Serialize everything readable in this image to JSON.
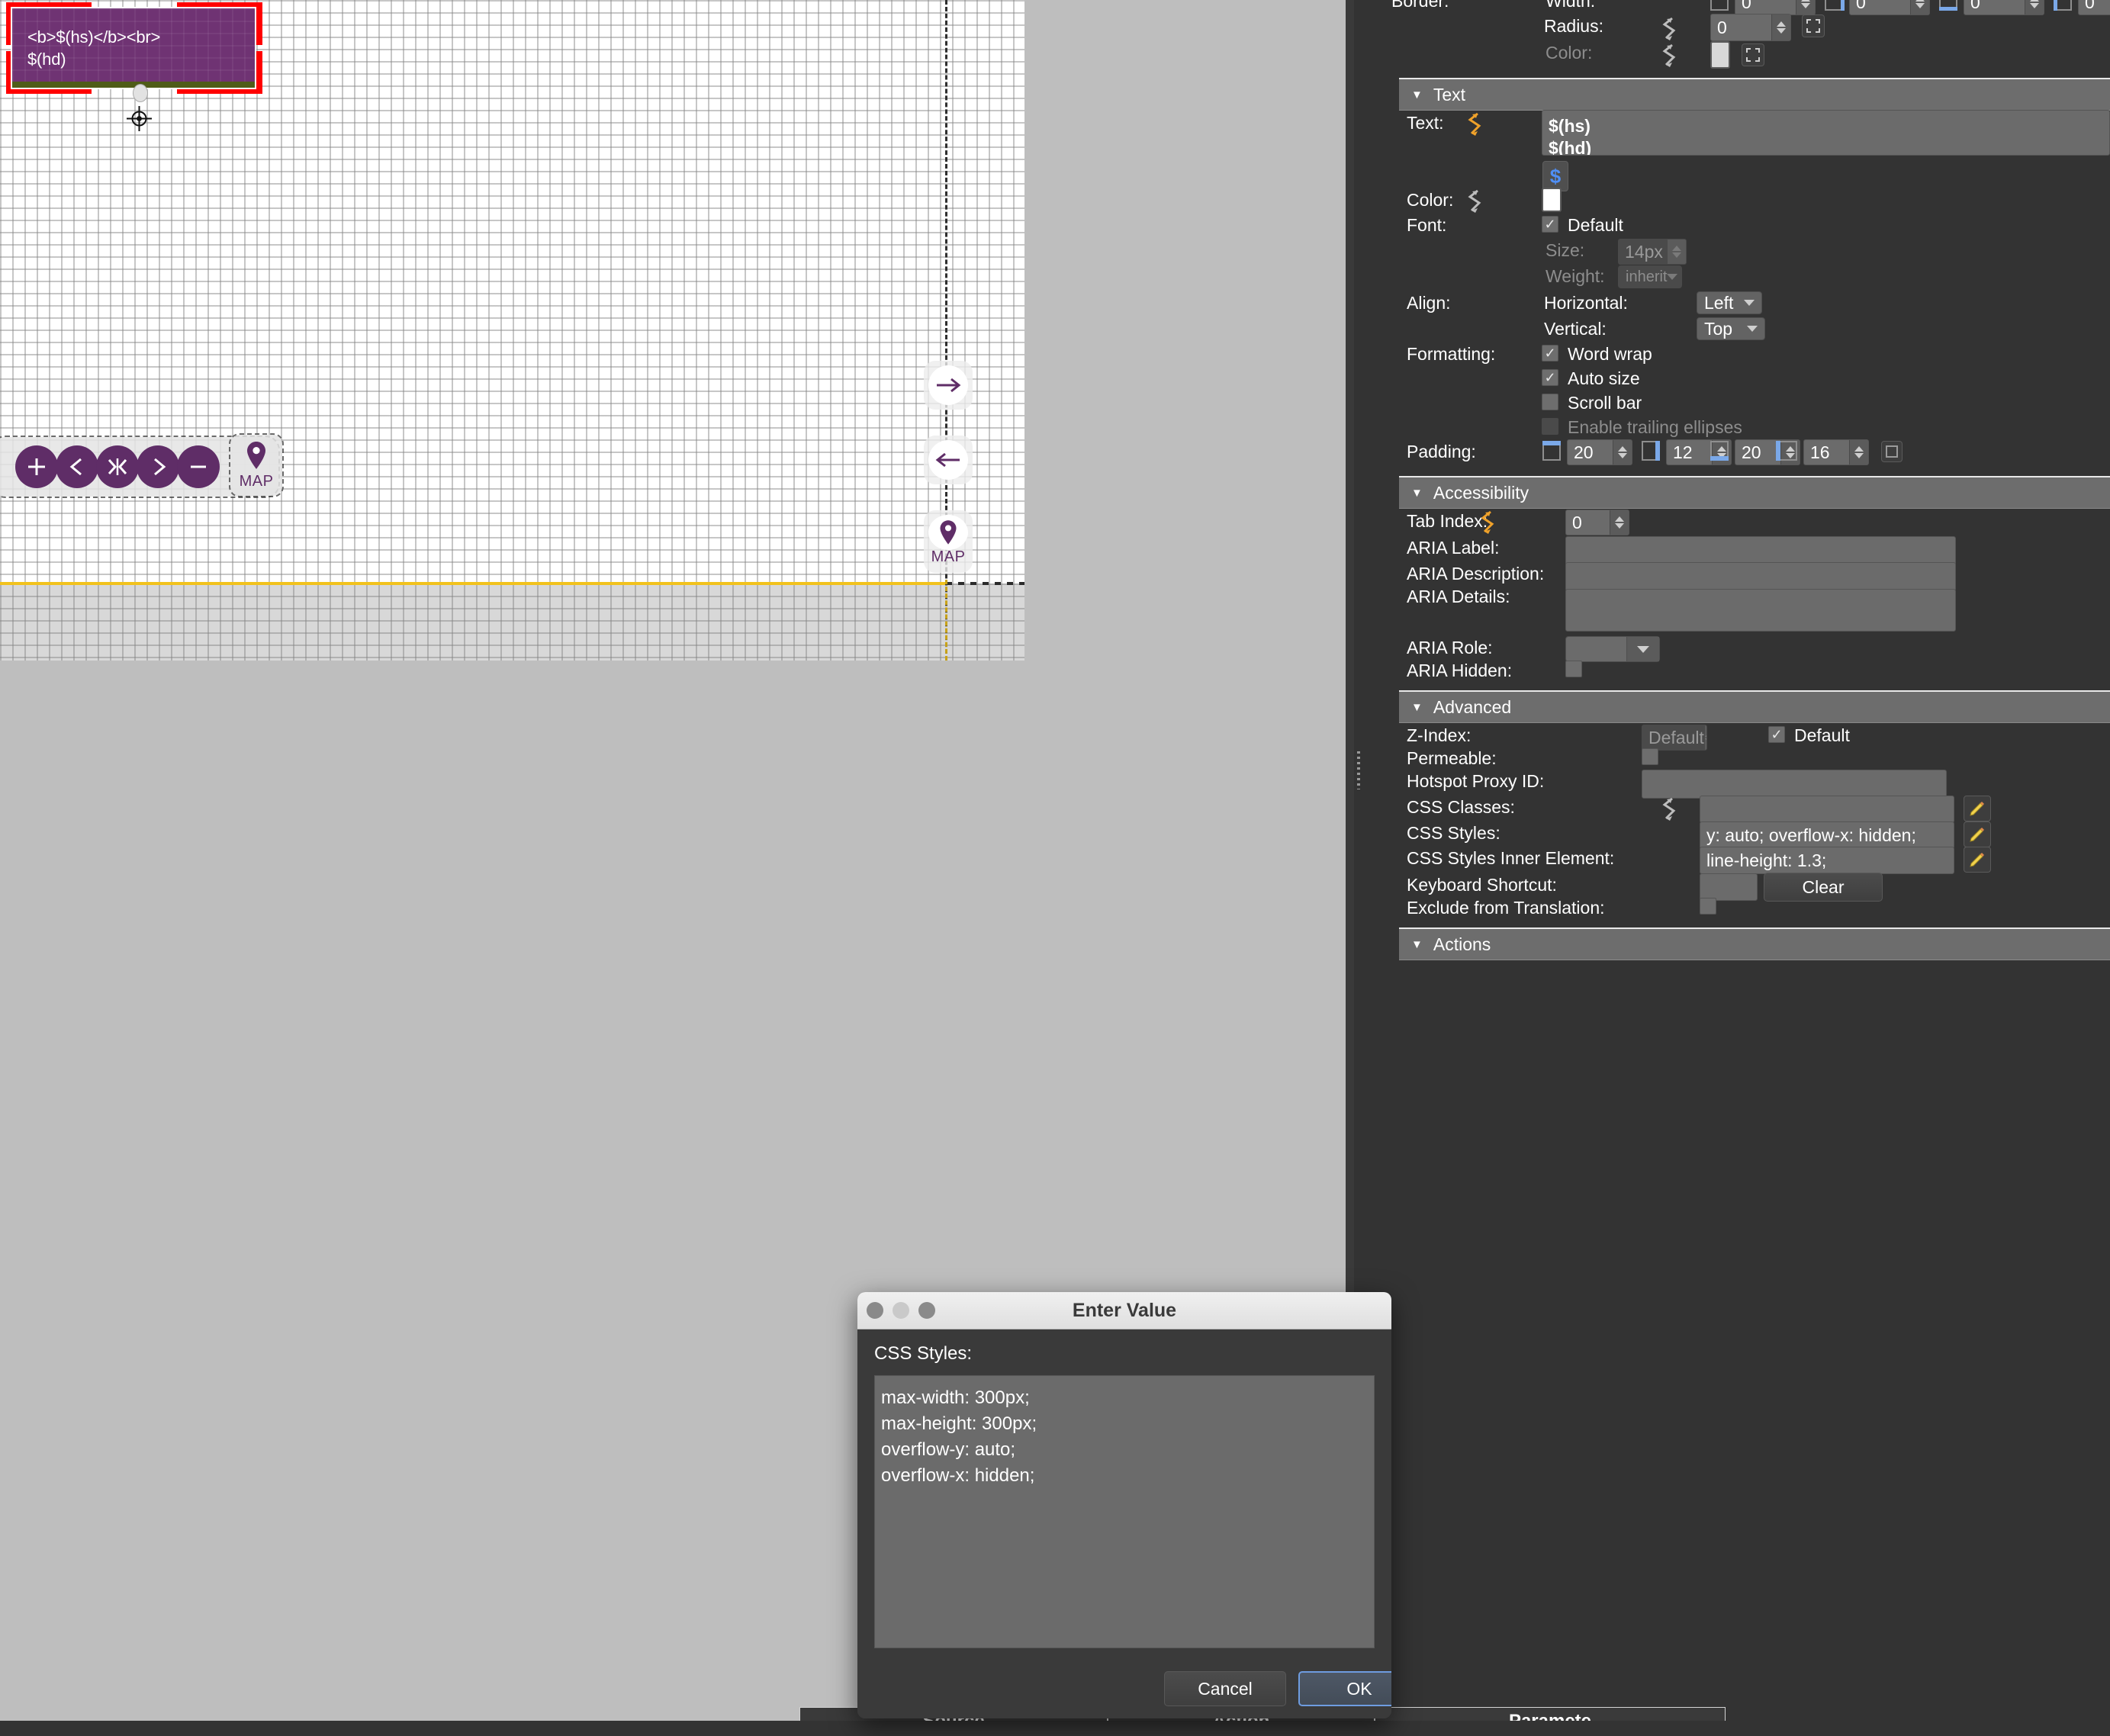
{
  "canvas": {
    "hotspot": {
      "text": "<b>$(hs)</b><br>\n$(hd)",
      "fill_color": "#6f3373"
    },
    "widget_bar": {
      "buttons": [
        {
          "name": "plus",
          "glyph": "+"
        },
        {
          "name": "prev",
          "glyph": "<"
        },
        {
          "name": "collapse",
          "glyph": ">|<"
        },
        {
          "name": "next",
          "glyph": ">"
        },
        {
          "name": "minus",
          "glyph": "−"
        }
      ]
    },
    "map_button_1": {
      "label": "MAP"
    },
    "map_button_2": {
      "label": "MAP"
    },
    "nav_forward": {
      "glyph": "→"
    },
    "nav_back": {
      "glyph": "←"
    }
  },
  "panel": {
    "border": {
      "label": "Border:",
      "width_label": "Width:",
      "widths": [
        "0",
        "0",
        "0",
        "0"
      ],
      "radius_label": "Radius:",
      "radius": "0",
      "color_label": "Color:"
    },
    "text_section": {
      "title": "Text",
      "text_label": "Text:",
      "text_value": "$(hs)\n$(hd)",
      "color_label": "Color:",
      "color_value": "#ffffff",
      "font_label": "Font:",
      "font_default_label": "Default",
      "font_default_checked": true,
      "size_label": "Size:",
      "size_value": "14px",
      "weight_label": "Weight:",
      "weight_value": "inherit",
      "align_label": "Align:",
      "horizontal_label": "Horizontal:",
      "horizontal_value": "Left",
      "vertical_label": "Vertical:",
      "vertical_value": "Top",
      "formatting_label": "Formatting:",
      "word_wrap_label": "Word wrap",
      "auto_size_label": "Auto size",
      "scroll_bar_label": "Scroll bar",
      "ellipses_label": "Enable trailing ellipses",
      "padding_label": "Padding:",
      "padding_top": "20",
      "padding_right": "12",
      "padding_bottom": "20",
      "padding_left": "16"
    },
    "accessibility": {
      "title": "Accessibility",
      "tab_index_label": "Tab Index:",
      "tab_index_value": "0",
      "aria_label_label": "ARIA Label:",
      "aria_label_value": "",
      "aria_description_label": "ARIA Description:",
      "aria_description_value": "",
      "aria_details_label": "ARIA Details:",
      "aria_details_value": "",
      "aria_role_label": "ARIA Role:",
      "aria_role_value": "",
      "aria_hidden_label": "ARIA Hidden:"
    },
    "advanced": {
      "title": "Advanced",
      "z_index_label": "Z-Index:",
      "z_index_value": "Default",
      "z_index_default_label": "Default",
      "permeable_label": "Permeable:",
      "hotspot_proxy_label": "Hotspot Proxy ID:",
      "hotspot_proxy_value": "",
      "css_classes_label": "CSS Classes:",
      "css_classes_value": "",
      "css_styles_label": "CSS Styles:",
      "css_styles_value": "y: auto; overflow-x: hidden;",
      "css_styles_inner_label": "CSS Styles Inner Element:",
      "css_styles_inner_value": "line-height: 1.3;",
      "keyboard_shortcut_label": "Keyboard Shortcut:",
      "keyboard_shortcut_value": "",
      "clear_label": "Clear",
      "exclude_translation_label": "Exclude from Translation:"
    },
    "actions": {
      "title": "Actions",
      "columns": [
        "Source",
        "Action",
        "Paramete"
      ]
    }
  },
  "dialog": {
    "title": "Enter Value",
    "field_label": "CSS Styles:",
    "value": "max-width: 300px;\nmax-height: 300px;\noverflow-y: auto;\noverflow-x: hidden;",
    "cancel_label": "Cancel",
    "ok_label": "OK"
  }
}
